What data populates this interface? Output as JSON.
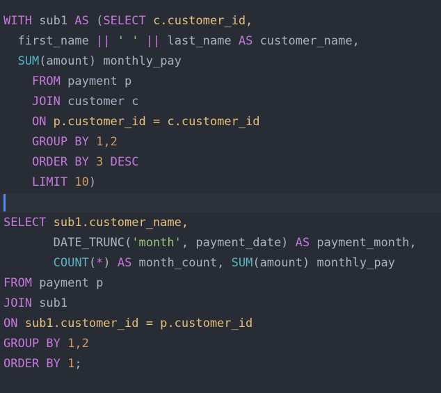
{
  "colors": {
    "background": "#282c34",
    "active_line": "#2c313a",
    "keyword": "#c678dd",
    "function": "#56b6c2",
    "string": "#98c379",
    "number": "#d19a66",
    "identifier": "#e5c07b",
    "plain": "#abb2bf",
    "cursor": "#528bff"
  },
  "lines": [
    [
      {
        "t": "WITH",
        "c": "kw"
      },
      {
        "t": " sub1 ",
        "c": "plain"
      },
      {
        "t": "AS",
        "c": "kw"
      },
      {
        "t": " (",
        "c": "plain"
      },
      {
        "t": "SELECT",
        "c": "kw"
      },
      {
        "t": " c.customer_id,",
        "c": "id"
      }
    ],
    [
      {
        "t": "  first_name ",
        "c": "plain"
      },
      {
        "t": "||",
        "c": "op"
      },
      {
        "t": " ",
        "c": "plain"
      },
      {
        "t": "' '",
        "c": "str"
      },
      {
        "t": " ",
        "c": "plain"
      },
      {
        "t": "||",
        "c": "op"
      },
      {
        "t": " last_name ",
        "c": "plain"
      },
      {
        "t": "AS",
        "c": "kw"
      },
      {
        "t": " customer_name,",
        "c": "plain"
      }
    ],
    [
      {
        "t": "  ",
        "c": "plain"
      },
      {
        "t": "SUM",
        "c": "fn"
      },
      {
        "t": "(amount) monthly_pay",
        "c": "plain"
      }
    ],
    [
      {
        "t": "    ",
        "c": "plain"
      },
      {
        "t": "FROM",
        "c": "kw"
      },
      {
        "t": " payment p",
        "c": "plain"
      }
    ],
    [
      {
        "t": "    ",
        "c": "plain"
      },
      {
        "t": "JOIN",
        "c": "kw"
      },
      {
        "t": " customer c",
        "c": "plain"
      }
    ],
    [
      {
        "t": "    ",
        "c": "plain"
      },
      {
        "t": "ON",
        "c": "kw"
      },
      {
        "t": " p.customer_id = c.customer_id",
        "c": "id"
      }
    ],
    [
      {
        "t": "    ",
        "c": "plain"
      },
      {
        "t": "GROUP BY",
        "c": "kw"
      },
      {
        "t": " ",
        "c": "plain"
      },
      {
        "t": "1,2",
        "c": "num"
      }
    ],
    [
      {
        "t": "    ",
        "c": "plain"
      },
      {
        "t": "ORDER BY",
        "c": "kw"
      },
      {
        "t": " ",
        "c": "plain"
      },
      {
        "t": "3",
        "c": "num"
      },
      {
        "t": " ",
        "c": "plain"
      },
      {
        "t": "DESC",
        "c": "kw"
      }
    ],
    [
      {
        "t": "    ",
        "c": "plain"
      },
      {
        "t": "LIMIT",
        "c": "kw"
      },
      {
        "t": " ",
        "c": "plain"
      },
      {
        "t": "10",
        "c": "num"
      },
      {
        "t": ")",
        "c": "plain"
      }
    ],
    [],
    [
      {
        "t": "SELECT",
        "c": "kw"
      },
      {
        "t": " sub1.customer_name,",
        "c": "id"
      }
    ],
    [
      {
        "t": "       DATE_TRUNC(",
        "c": "plain"
      },
      {
        "t": "'month'",
        "c": "str"
      },
      {
        "t": ", payment_date) ",
        "c": "plain"
      },
      {
        "t": "AS",
        "c": "kw"
      },
      {
        "t": " payment_month,",
        "c": "plain"
      }
    ],
    [
      {
        "t": "       ",
        "c": "plain"
      },
      {
        "t": "COUNT",
        "c": "fn"
      },
      {
        "t": "(",
        "c": "plain"
      },
      {
        "t": "*",
        "c": "kw"
      },
      {
        "t": ") ",
        "c": "plain"
      },
      {
        "t": "AS",
        "c": "kw"
      },
      {
        "t": " month_count, ",
        "c": "plain"
      },
      {
        "t": "SUM",
        "c": "fn"
      },
      {
        "t": "(amount) monthly_pay",
        "c": "plain"
      }
    ],
    [
      {
        "t": "FROM",
        "c": "kw"
      },
      {
        "t": " payment p",
        "c": "plain"
      }
    ],
    [
      {
        "t": "JOIN",
        "c": "kw"
      },
      {
        "t": " sub1",
        "c": "plain"
      }
    ],
    [
      {
        "t": "ON",
        "c": "kw"
      },
      {
        "t": " sub1.customer_id = p.customer_id",
        "c": "id"
      }
    ],
    [
      {
        "t": "GROUP BY",
        "c": "kw"
      },
      {
        "t": " ",
        "c": "plain"
      },
      {
        "t": "1,2",
        "c": "num"
      }
    ],
    [
      {
        "t": "ORDER BY",
        "c": "kw"
      },
      {
        "t": " ",
        "c": "plain"
      },
      {
        "t": "1",
        "c": "num"
      },
      {
        "t": ";",
        "c": "plain"
      }
    ]
  ],
  "active_line_index": 9
}
